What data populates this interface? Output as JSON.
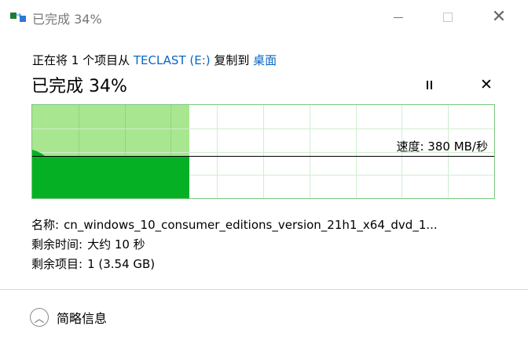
{
  "window": {
    "title": "已完成 34%",
    "icon": "file-copy-icon"
  },
  "copy": {
    "prefix": "正在将 1 个项目从 ",
    "source": "TECLAST (E:)",
    "middle": " 复制到 ",
    "destination": "桌面",
    "status": "已完成 34%",
    "progress_percent": 34
  },
  "controls": {
    "pause_icon": "pause-icon",
    "stop_icon": "close-icon"
  },
  "graph": {
    "speed_label": "速度: 380 MB/秒",
    "fill_color": "#06b025",
    "history_color": "#a8e68f",
    "grid_color": "#cfeecf"
  },
  "details": {
    "name_label": "名称:",
    "name_value": "cn_windows_10_consumer_editions_version_21h1_x64_dvd_1...",
    "time_label": "剩余时间:",
    "time_value": "大约 10 秒",
    "items_label": "剩余项目:",
    "items_value": "1 (3.54 GB)"
  },
  "footer": {
    "toggle_label": "简略信息"
  }
}
